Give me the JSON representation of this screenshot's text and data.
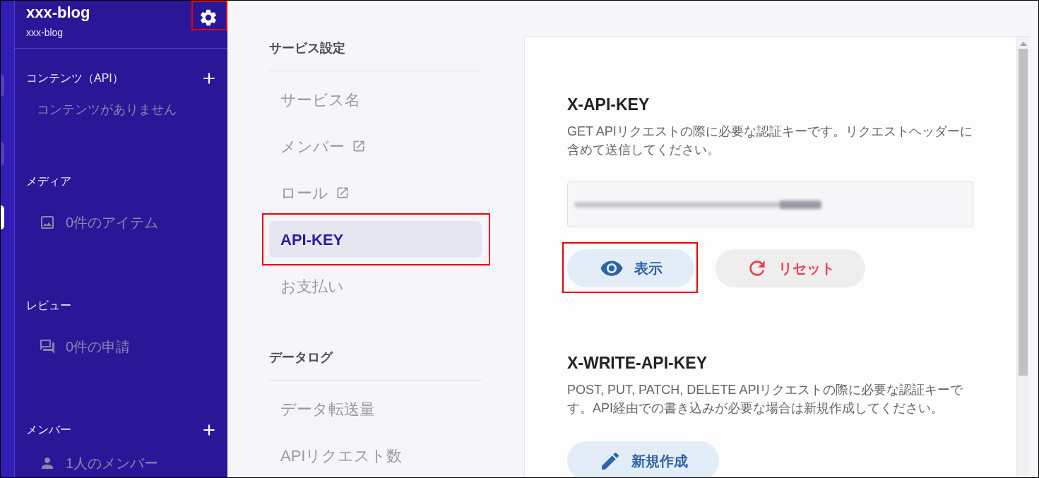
{
  "sidebar": {
    "service_name": "xxx-blog",
    "service_id": "xxx-blog",
    "settings_highlighted": true,
    "sections": [
      {
        "title": "コンテンツ（API）",
        "addable": true,
        "items": [
          {
            "kind": "empty",
            "label": "コンテンツがありません"
          }
        ]
      },
      {
        "title": "メディア",
        "addable": false,
        "items": [
          {
            "kind": "media",
            "label": "0件のアイテム"
          }
        ]
      },
      {
        "title": "レビュー",
        "addable": false,
        "items": [
          {
            "kind": "review",
            "label": "0件の申請"
          }
        ]
      },
      {
        "title": "メンバー",
        "addable": true,
        "items": [
          {
            "kind": "member",
            "label": "1人のメンバー"
          }
        ]
      }
    ]
  },
  "settings_nav": {
    "groups": [
      {
        "title": "サービス設定",
        "items": [
          {
            "label": "サービス名",
            "external": false,
            "selected": false,
            "highlighted": false
          },
          {
            "label": "メンバー",
            "external": true,
            "selected": false,
            "highlighted": false
          },
          {
            "label": "ロール",
            "external": true,
            "selected": false,
            "highlighted": false
          },
          {
            "label": "API-KEY",
            "external": false,
            "selected": true,
            "highlighted": true
          },
          {
            "label": "お支払い",
            "external": false,
            "selected": false,
            "highlighted": false
          }
        ]
      },
      {
        "title": "データログ",
        "items": [
          {
            "label": "データ転送量",
            "external": false,
            "selected": false,
            "highlighted": false
          },
          {
            "label": "APIリクエスト数",
            "external": false,
            "selected": false,
            "highlighted": false
          }
        ]
      }
    ]
  },
  "api_keys": [
    {
      "title": "X-API-KEY",
      "description": "GET APIリクエストの際に必要な認証キーです。リクエストヘッダーに含めて送信してください。",
      "field": {
        "blurred": true
      },
      "buttons": [
        {
          "kind": "show",
          "label": "表示",
          "highlighted": true
        },
        {
          "kind": "reset",
          "label": "リセット",
          "highlighted": false
        }
      ]
    },
    {
      "title": "X-WRITE-API-KEY",
      "description": "POST, PUT, PATCH, DELETE APIリクエストの際に必要な認証キーです。API経由での書き込みが必要な場合は新規作成してください。",
      "buttons": [
        {
          "kind": "create",
          "label": "新規作成",
          "highlighted": false
        }
      ]
    }
  ]
}
